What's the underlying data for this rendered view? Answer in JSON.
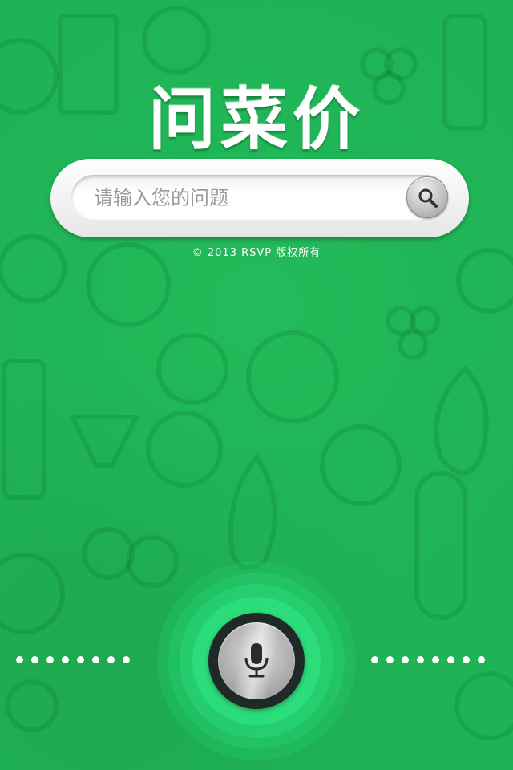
{
  "app": {
    "title": "问菜价"
  },
  "search": {
    "placeholder": "请输入您的问题"
  },
  "footer": {
    "copyright": "© 2013 RSVP 版权所有"
  },
  "icons": {
    "search": "search-icon",
    "mic": "microphone-icon"
  },
  "colors": {
    "background": "#1fb355",
    "glow": "#22d978",
    "title": "#ffffff"
  }
}
